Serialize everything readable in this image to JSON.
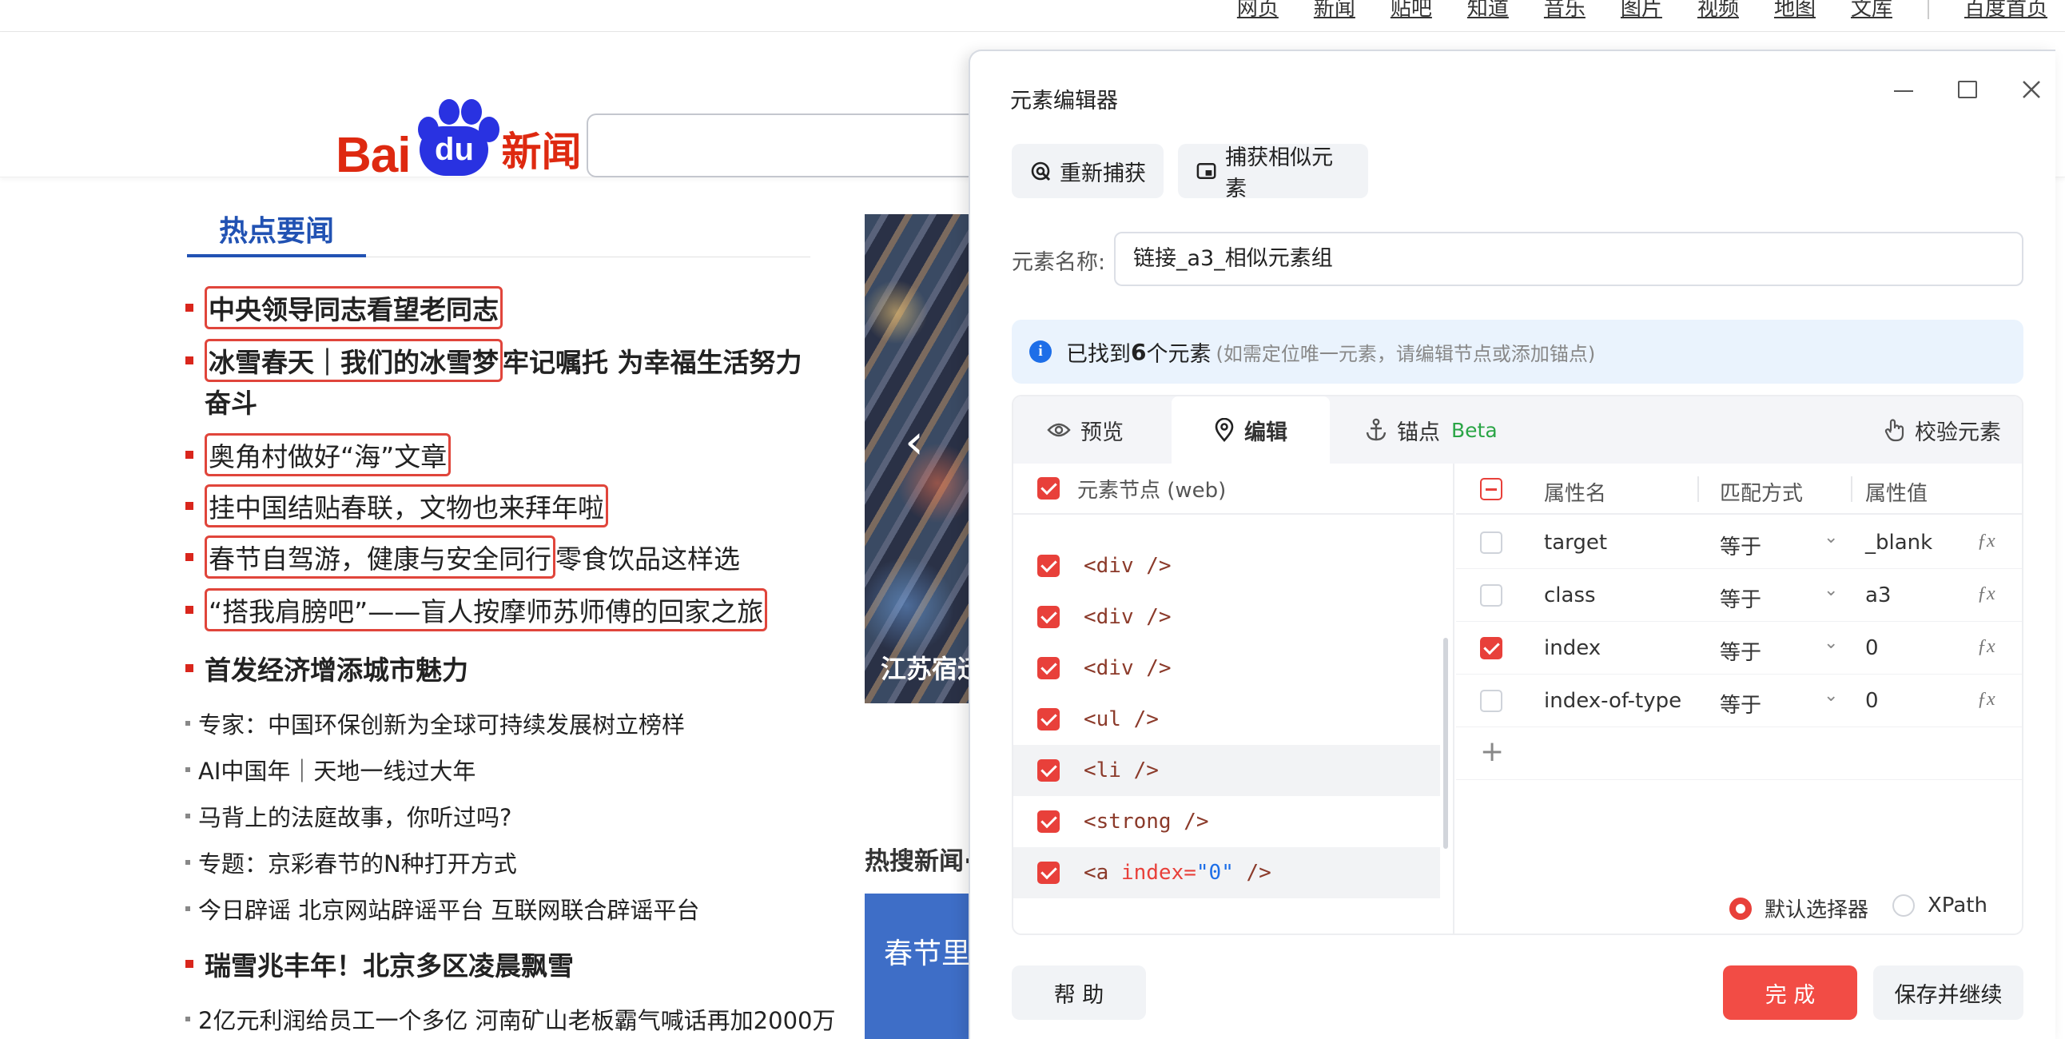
{
  "topnav": {
    "links": [
      "网页",
      "新闻",
      "贴吧",
      "知道",
      "音乐",
      "图片",
      "视频",
      "地图",
      "文库"
    ],
    "home": "百度首页"
  },
  "logo": {
    "bai": "Bai",
    "du": "du",
    "news": "新闻"
  },
  "hot_news": {
    "title": "热点要闻",
    "items": [
      {
        "text": "中央领导同志看望老同志",
        "extra": ""
      },
      {
        "text": "冰雪春天｜我们的冰雪梦",
        "extra": " 牢记嘱托 为幸福生活努力"
      },
      {
        "text": "奋斗"
      },
      {
        "text": "奥角村做好“海”文章"
      },
      {
        "text": "挂中国结贴春联，文物也来拜年啦"
      },
      {
        "text": "春节自驾游，健康与安全同行",
        "extra": " 零食饮品这样选"
      },
      {
        "text": "“搭我肩膀吧”——盲人按摩师苏师傅的回家之旅"
      },
      {
        "text": "首发经济增添城市魅力"
      },
      {
        "text": "专家：中国环保创新为全球可持续发展树立榜样"
      },
      {
        "text": "AI中国年｜天地一线过大年"
      },
      {
        "text": "马背上的法庭故事，你听过吗?"
      },
      {
        "text": "专题：京彩春节的N种打开方式"
      },
      {
        "text": "今日辟谣 北京网站辟谣平台 互联网联合辟谣平台"
      },
      {
        "text": "瑞雪兆丰年！北京多区凌晨飘雪"
      },
      {
        "text": "2亿元利润给员工一个多亿 河南矿山老板霸气喊话再加2000万"
      }
    ]
  },
  "photo": {
    "caption": "江苏宿迁",
    "arrow": "‹"
  },
  "hot_search": {
    "title": "热搜新闻·",
    "card": "春节里"
  },
  "editor": {
    "title": "元素编辑器",
    "recapture_label": "重新捕获",
    "capture_similar_label": "捕获相似元素",
    "name_label": "元素名称:",
    "name_value": "链接_a3_相似元素组",
    "info": {
      "prefix": "已找到",
      "count": "6",
      "suffix": "个元素",
      "hint": "(如需定位唯一元素，请编辑节点或添加锚点)"
    },
    "tabs": {
      "preview": "预览",
      "edit": "编辑",
      "anchor": "锚点",
      "beta": "Beta",
      "verify": "校验元素"
    },
    "tree_header": "元素节点 (web)",
    "nodes": [
      {
        "tag": "<div />",
        "checked": true
      },
      {
        "tag": "<div />",
        "checked": true
      },
      {
        "tag": "<div />",
        "checked": true
      },
      {
        "tag": "<ul />",
        "checked": true
      },
      {
        "tag": "<li />",
        "checked": true
      },
      {
        "tag": "<strong />",
        "checked": true
      },
      {
        "tag_open": "<a ",
        "attr": "index=",
        "val": "\"0\"",
        "tag_close": " />",
        "checked": true
      }
    ],
    "prop_headers": {
      "name": "属性名",
      "match": "匹配方式",
      "value": "属性值"
    },
    "props": [
      {
        "name": "target",
        "match": "等于",
        "value": "_blank",
        "checked": false
      },
      {
        "name": "class",
        "match": "等于",
        "value": "a3",
        "checked": false
      },
      {
        "name": "index",
        "match": "等于",
        "value": "0",
        "checked": true
      },
      {
        "name": "index-of-type",
        "match": "等于",
        "value": "0",
        "checked": false
      }
    ],
    "add_symbol": "+",
    "selector_options": {
      "default": "默认选择器",
      "xpath": "XPath",
      "selected": "默认选择器"
    },
    "buttons": {
      "help": "帮 助",
      "done": "完 成",
      "save_continue": "保存并继续"
    },
    "colors": {
      "accent": "#e8403a",
      "info_bg": "#eaf3fd",
      "info_icon": "#1d6ee8",
      "beta": "#2aa546"
    }
  }
}
